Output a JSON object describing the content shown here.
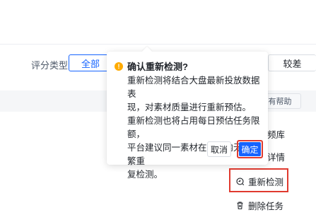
{
  "filters": {
    "score_type_label": "评分类型",
    "options": [
      "全部",
      "较差"
    ]
  },
  "help_button": "有帮助",
  "menu": {
    "partial_top": "频库",
    "partial_mid": "详情",
    "recheck": "重新检测",
    "delete": "删除任务"
  },
  "popover": {
    "title": "确认重新检测?",
    "line1": "重新检测将结合大盘最新投放数据表",
    "line2": "现，对素材质量进行重新预估。",
    "line3": "重新检测也将占用每日预估任务限额，",
    "line4": "平台建议同一素材在一天内无需频繁重",
    "line5": "复检测。",
    "cancel": "取消",
    "confirm": "确定"
  },
  "colors": {
    "primary": "#1664ff",
    "highlight": "#e03a2f",
    "warning": "#ffab00"
  }
}
